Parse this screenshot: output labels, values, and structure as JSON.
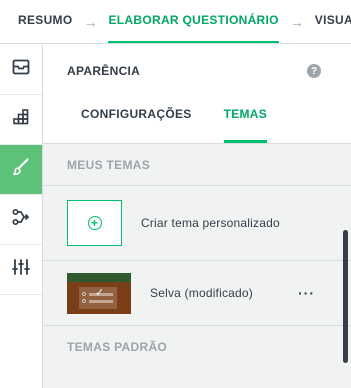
{
  "topnav": {
    "steps": [
      {
        "label": "RESUMO"
      },
      {
        "label": "ELABORAR QUESTIONÁRIO"
      },
      {
        "label": "VISUAL"
      }
    ]
  },
  "rail": {
    "items": [
      {
        "icon": "inbox-icon"
      },
      {
        "icon": "logic-grid-icon"
      },
      {
        "icon": "paintbrush-icon"
      },
      {
        "icon": "branch-icon"
      },
      {
        "icon": "sliders-icon"
      }
    ],
    "active_color": "#5ec17a"
  },
  "panel": {
    "title": "APARÊNCIA",
    "help_glyph": "?",
    "tabs": [
      {
        "label": "CONFIGURAÇÕES"
      },
      {
        "label": "TEMAS"
      }
    ],
    "my_themes_label": "MEUS TEMAS",
    "create_theme_label": "Criar tema personalizado",
    "theme_name": "Selva (modificado)",
    "more_glyph": "···",
    "default_themes_label": "TEMAS PADRÃO"
  },
  "colors": {
    "accent": "#00bf6f",
    "accent_text": "#00a766",
    "text": "#333e48",
    "muted": "#9da5ab",
    "panel_bg": "#f1f2f2"
  }
}
